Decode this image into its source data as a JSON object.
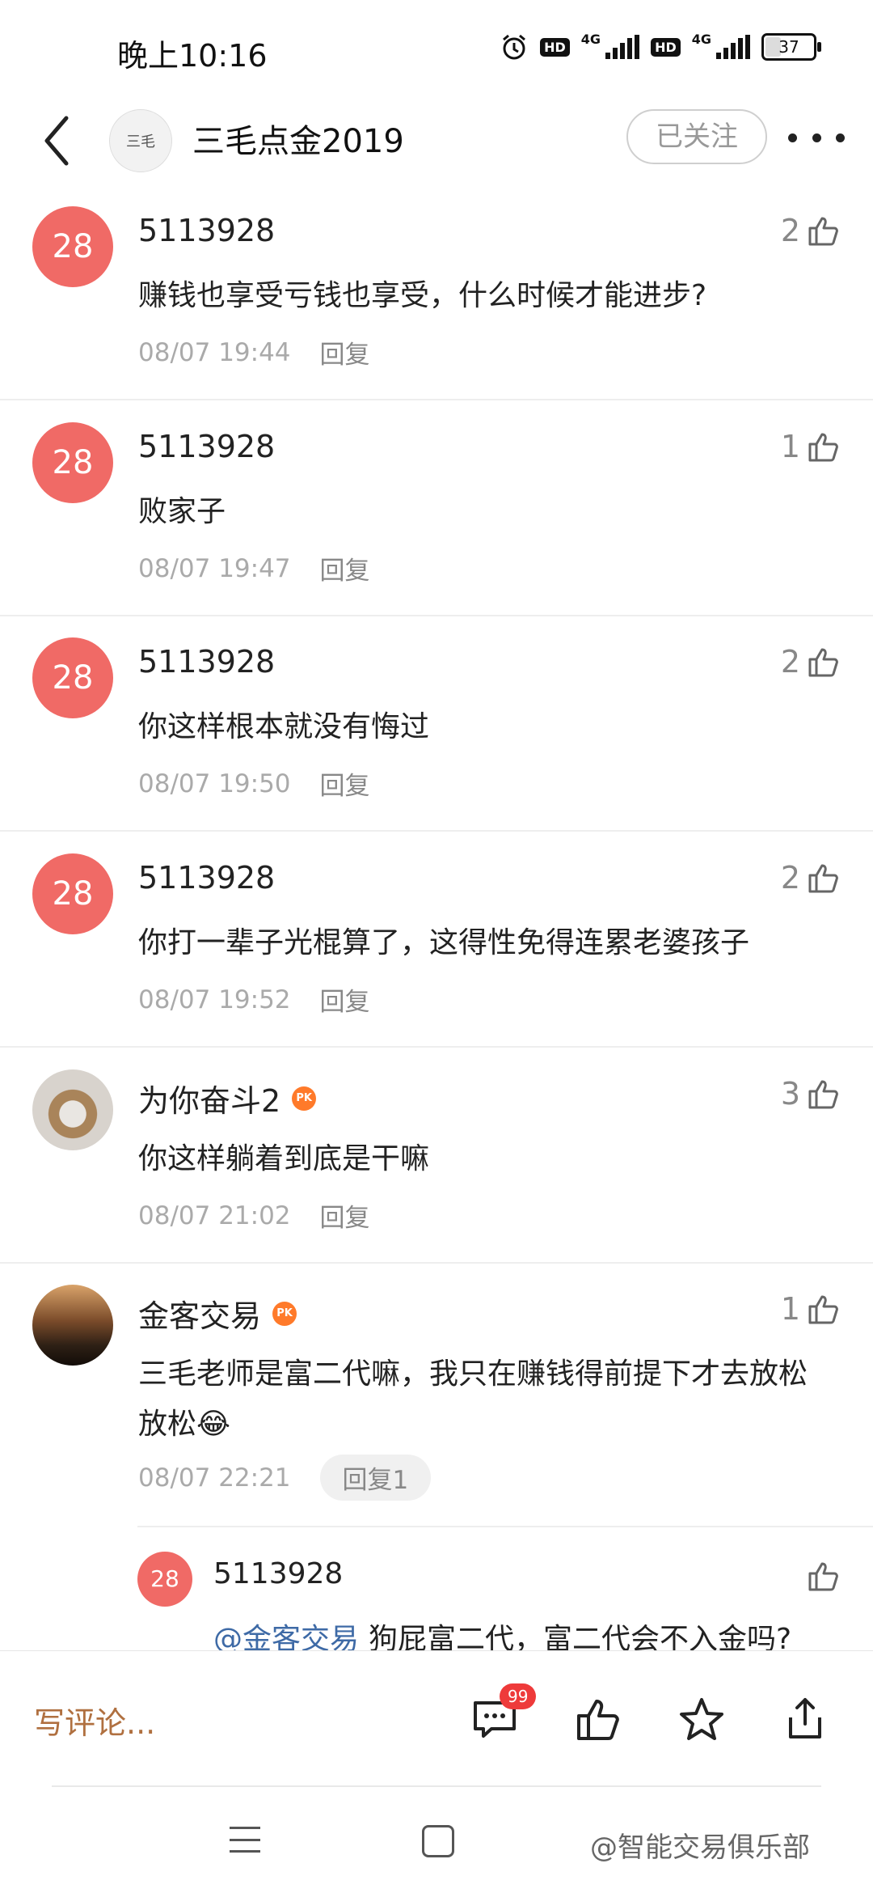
{
  "status": {
    "time": "晚上10:16",
    "net1": "4G",
    "net2": "4G",
    "hd": "HD",
    "battery": "37",
    "battery_level": 0.37
  },
  "header": {
    "title": "三毛点金2019",
    "avatar_text": "三毛",
    "follow_label": "已关注"
  },
  "comments": [
    {
      "avatar": "28",
      "name": "5113928",
      "likes": "2",
      "text": "赚钱也享受亏钱也享受，什么时候才能进步?",
      "time": "08/07 19:44",
      "reply": "回复"
    },
    {
      "avatar": "28",
      "name": "5113928",
      "likes": "1",
      "text": "败家子",
      "time": "08/07 19:47",
      "reply": "回复"
    },
    {
      "avatar": "28",
      "name": "5113928",
      "likes": "2",
      "text": "你这样根本就没有悔过",
      "time": "08/07 19:50",
      "reply": "回复"
    },
    {
      "avatar": "28",
      "name": "5113928",
      "likes": "2",
      "text": "你打一辈子光棍算了，这得性免得连累老婆孩子",
      "time": "08/07 19:52",
      "reply": "回复"
    },
    {
      "name": "为你奋斗2",
      "badge": "PK",
      "likes": "3",
      "text": "你这样躺着到底是干嘛",
      "time": "08/07 21:02",
      "reply": "回复"
    },
    {
      "name": "金客交易",
      "badge": "PK",
      "likes": "1",
      "text": "三毛老师是富二代嘛，我只在赚钱得前提下才去放松放松😂",
      "time": "08/07 22:21",
      "reply": "回复1"
    }
  ],
  "nested_reply": {
    "avatar": "28",
    "name": "5113928",
    "mention": "@金客交易",
    "text": "狗屁富二代，富二代会不入金吗?"
  },
  "action_bar": {
    "write_placeholder": "写评论...",
    "comment_count": "99"
  },
  "watermark": "@智能交易俱乐部"
}
